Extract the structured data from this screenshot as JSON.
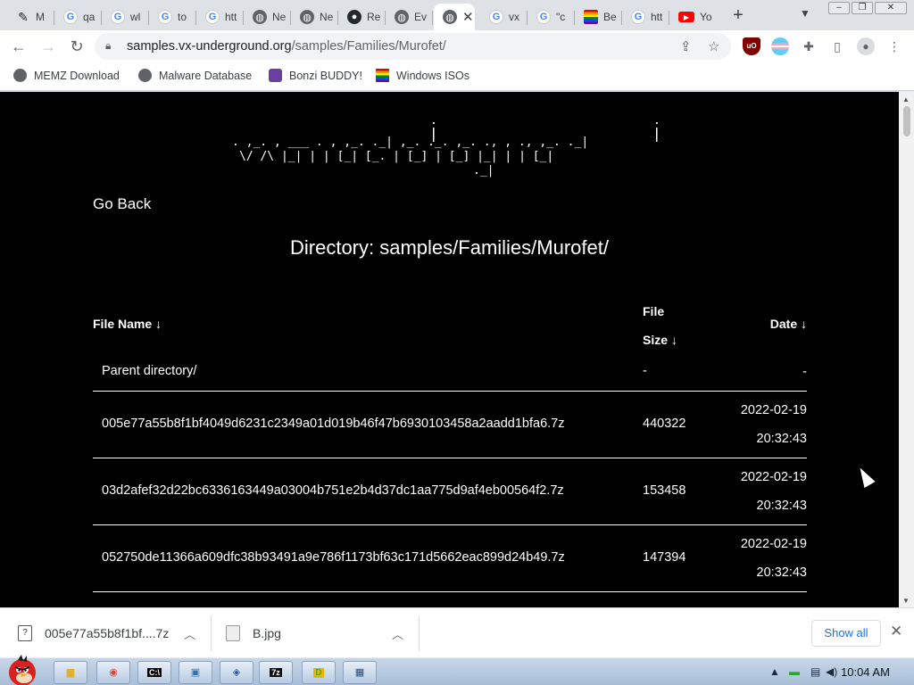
{
  "browser": {
    "tabs": [
      {
        "label": "M",
        "icon": "pen-icon"
      },
      {
        "label": "qa",
        "icon": "google-icon"
      },
      {
        "label": "wl",
        "icon": "google-icon"
      },
      {
        "label": "to",
        "icon": "google-icon"
      },
      {
        "label": "htt",
        "icon": "google-icon"
      },
      {
        "label": "Ne",
        "icon": "globe-icon"
      },
      {
        "label": "Ne",
        "icon": "globe-icon"
      },
      {
        "label": "Re",
        "icon": "github-icon"
      },
      {
        "label": "Ev",
        "icon": "globe-icon"
      },
      {
        "label": "",
        "icon": "globe-icon",
        "active": true
      },
      {
        "label": "vx",
        "icon": "google-icon"
      },
      {
        "label": "\"c",
        "icon": "google-icon"
      },
      {
        "label": "Be",
        "icon": "rainbow-flag-icon"
      },
      {
        "label": "htt",
        "icon": "google-icon"
      },
      {
        "label": "Yo",
        "icon": "youtube-icon"
      }
    ],
    "url_host": "samples.vx-underground.org",
    "url_path": "/samples/Families/Murofet/",
    "bookmarks": [
      {
        "label": "MEMZ Download",
        "icon": "globe-icon"
      },
      {
        "label": "Malware Database",
        "icon": "globe-icon"
      },
      {
        "label": "Bonzi BUDDY!",
        "icon": "bonzi-icon"
      },
      {
        "label": "Windows ISOs",
        "icon": "rainbow-flag-icon"
      }
    ]
  },
  "page": {
    "go_back": "Go Back",
    "directory_title": "Directory: samples/Families/Murofet/",
    "headers": {
      "name": "File Name ↓",
      "size_line1": "File",
      "size_line2": "Size ↓",
      "date": "Date ↓"
    },
    "parent_row": {
      "name": "Parent directory/",
      "size": "-",
      "date": "-"
    },
    "rows": [
      {
        "name": "005e77a55b8f1bf4049d6231c2349a01d019b46f47b6930103458a2aadd1bfa6.7z",
        "size": "440322",
        "date": "2022-02-19",
        "time": "20:32:43"
      },
      {
        "name": "03d2afef32d22bc6336163449a03004b751e2b4d37dc1aa775d9af4eb00564f2.7z",
        "size": "153458",
        "date": "2022-02-19",
        "time": "20:32:43"
      },
      {
        "name": "052750de11366a609dfc38b93491a9e786f1173bf63c171d5662eac899d24b49.7z",
        "size": "147394",
        "date": "2022-02-19",
        "time": "20:32:43"
      }
    ]
  },
  "downloads": {
    "items": [
      {
        "name": "005e77a55b8f1bf....7z",
        "icon": "unknown-file-icon"
      },
      {
        "name": "B.jpg",
        "icon": "image-file-icon"
      }
    ],
    "show_all": "Show all"
  },
  "taskbar": {
    "clock": "10:04 AM",
    "buttons": [
      "folder",
      "chrome",
      "cmd",
      "explorer",
      "network",
      "7z",
      "app",
      "calc"
    ]
  }
}
